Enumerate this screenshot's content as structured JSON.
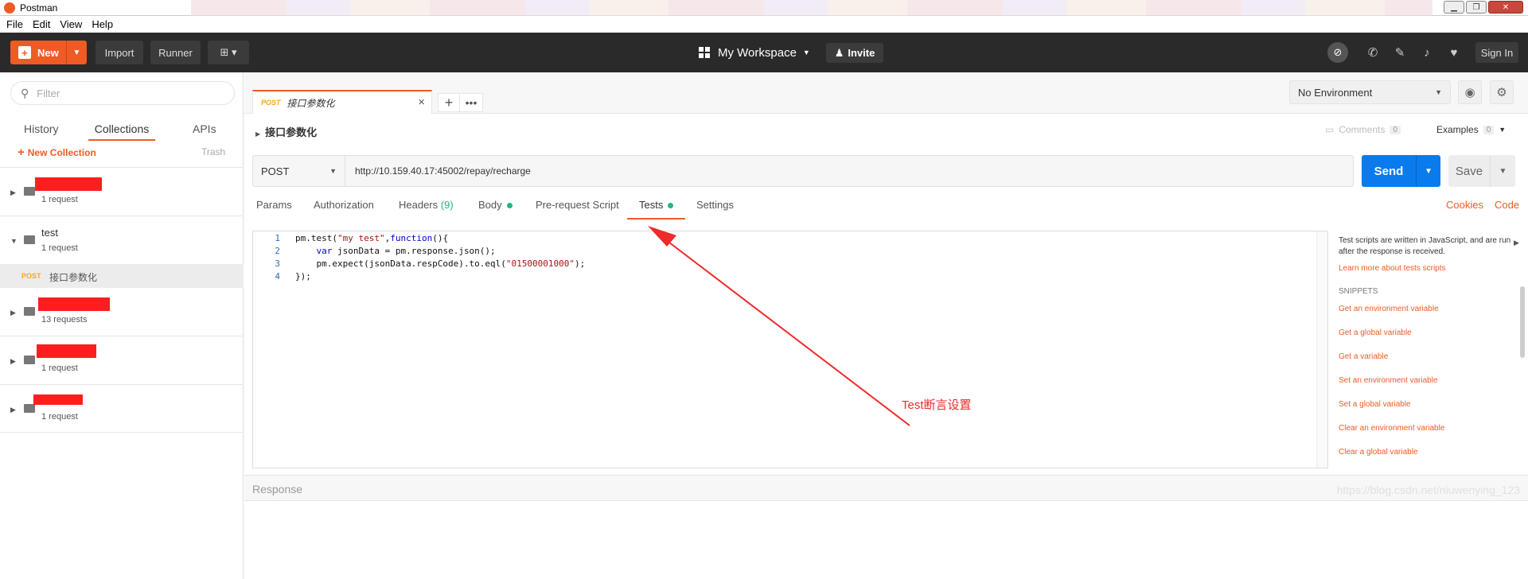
{
  "window": {
    "title": "Postman",
    "controls": {
      "minimize": "▁",
      "maximize": "❐",
      "close": "✕"
    }
  },
  "menu": [
    "File",
    "Edit",
    "View",
    "Help"
  ],
  "toolbar": {
    "new_label": "New",
    "import_label": "Import",
    "runner_label": "Runner",
    "workspace_label": "My Workspace",
    "invite_label": "Invite",
    "signin_label": "Sign In"
  },
  "sidebar": {
    "filter_placeholder": "Filter",
    "tabs": [
      "History",
      "Collections",
      "APIs"
    ],
    "new_collection_label": "New Collection",
    "trash_label": "Trash",
    "collections": [
      {
        "name": "",
        "count": "1 request"
      },
      {
        "name": "test",
        "count": "1 request"
      },
      {
        "name": "",
        "count": "13 requests"
      },
      {
        "name": "",
        "count": "1 request"
      },
      {
        "name": "",
        "count": "1 request"
      }
    ],
    "request_item": {
      "method": "POST",
      "name": "接口参数化"
    }
  },
  "request_tab": {
    "method": "POST",
    "name": "接口参数化"
  },
  "environment": {
    "selected": "No Environment"
  },
  "breadcrumb": "接口参数化",
  "comments": {
    "label": "Comments",
    "count": "0"
  },
  "examples": {
    "label": "Examples",
    "count": "0"
  },
  "url_bar": {
    "method": "POST",
    "url": "http://10.159.40.17:45002/repay/recharge",
    "send_label": "Send",
    "save_label": "Save"
  },
  "request_tabs": {
    "params": "Params",
    "authorization": "Authorization",
    "headers": "Headers",
    "headers_count": "(9)",
    "body": "Body",
    "prerequest": "Pre-request Script",
    "tests": "Tests",
    "settings": "Settings",
    "cookies": "Cookies",
    "code": "Code"
  },
  "editor": {
    "line_numbers": [
      "1",
      "2",
      "3",
      "4"
    ],
    "lines": {
      "l1_a": "pm.test(",
      "l1_b": "\"my test\"",
      "l1_c": ",",
      "l1_d": "function",
      "l1_e": "(){",
      "l2_a": "    ",
      "l2_b": "var",
      "l2_c": " jsonData = pm.response.json();",
      "l3_a": "    pm.expect(jsonData.respCode).to.eql(",
      "l3_b": "\"01500001000\"",
      "l3_c": ");",
      "l4_a": "});"
    }
  },
  "helper": {
    "description": "Test scripts are written in JavaScript, and are run after the response is received.",
    "learn_more": "Learn more about tests scripts",
    "snippets_heading": "SNIPPETS",
    "snippets": [
      "Get an environment variable",
      "Get a global variable",
      "Get a variable",
      "Set an environment variable",
      "Set a global variable",
      "Clear an environment variable",
      "Clear a global variable"
    ]
  },
  "response_label": "Response",
  "annotation": "Test断言设置",
  "watermark": "https://blog.csdn.net/niuwenying_123",
  "colors": {
    "accent": "#ef5b25",
    "send_blue": "#097bed",
    "topbar": "#2a2a2a",
    "annotation_red": "#ee2a2a"
  }
}
